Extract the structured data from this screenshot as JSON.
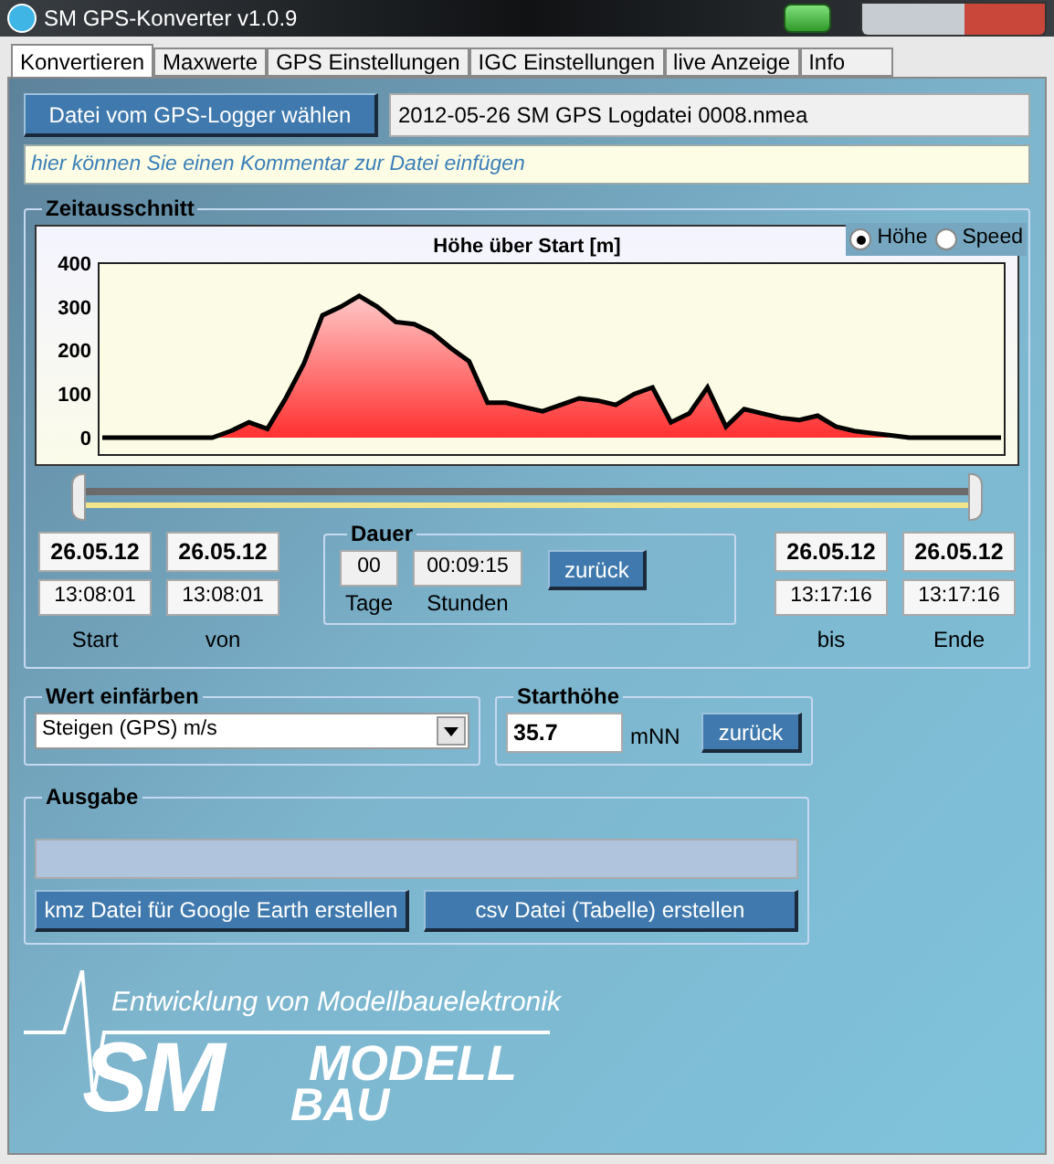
{
  "window": {
    "title": "SM GPS-Konverter v1.0.9"
  },
  "tabs": [
    {
      "label": "Konvertieren",
      "selected": true
    },
    {
      "label": "Maxwerte",
      "selected": false
    },
    {
      "label": "GPS Einstellungen",
      "selected": false
    },
    {
      "label": "IGC Einstellungen",
      "selected": false
    },
    {
      "label": "live Anzeige",
      "selected": false
    },
    {
      "label": "Info",
      "selected": false
    }
  ],
  "file": {
    "button": "Datei vom GPS-Logger wählen",
    "value": "2012-05-26 SM GPS Logdatei 0008.nmea",
    "comment_placeholder": "hier können Sie einen Kommentar zur Datei einfügen"
  },
  "zeitausschnitt": {
    "title": "Zeitausschnitt",
    "modes": [
      {
        "label": "Höhe",
        "selected": true
      },
      {
        "label": "Speed",
        "selected": false
      }
    ],
    "chart_data": {
      "type": "area",
      "title": "Höhe über Start [m]",
      "ylim": [
        -40,
        400
      ],
      "yticks": [
        0,
        100,
        200,
        300,
        400
      ],
      "categories": [
        null,
        null,
        null,
        null,
        null,
        null,
        null,
        null,
        null,
        null,
        null,
        null,
        null,
        null,
        null,
        null,
        null,
        null,
        null,
        null,
        null,
        null,
        null,
        null,
        null,
        null,
        null,
        null,
        null,
        null,
        null,
        null,
        null,
        null,
        null,
        null,
        null,
        null,
        null,
        null,
        null,
        null,
        null,
        null,
        null,
        null,
        null,
        null,
        null,
        null
      ],
      "series": [
        {
          "color": "#000000",
          "values": [
            0,
            0,
            0,
            0,
            0,
            0,
            0,
            15,
            35,
            20,
            90,
            170,
            280,
            300,
            325,
            300,
            265,
            260,
            240,
            205,
            175,
            80,
            80,
            70,
            60,
            75,
            90,
            85,
            75,
            100,
            115,
            35,
            55,
            115,
            25,
            65,
            55,
            45,
            40,
            50,
            25,
            15,
            10,
            5,
            0,
            0,
            0,
            0,
            0,
            0
          ]
        }
      ]
    },
    "slider": {
      "handles": [
        {
          "level": 0
        },
        {
          "level": 1
        }
      ]
    },
    "start": {
      "date": "26.05.12",
      "time": "13:08:01",
      "label": "Start"
    },
    "von": {
      "date": "26.05.12",
      "time": "13:08:01",
      "label": "von"
    },
    "dauer": {
      "title": "Dauer",
      "days": "00",
      "days_label": "Tage",
      "hours": "00:09:15",
      "hours_label": "Stunden",
      "button": "zurück"
    },
    "bis": {
      "date": "26.05.12",
      "time": "13:17:16",
      "label": "bis"
    },
    "ende": {
      "date": "26.05.12",
      "time": "13:17:16",
      "label": "Ende"
    }
  },
  "wert_einfaerben": {
    "title": "Wert einfärben",
    "value": "Steigen (GPS) m/s"
  },
  "starthoehe": {
    "title": "Starthöhe",
    "value": "35.7",
    "unit": "mNN",
    "button": "zurück"
  },
  "ausgabe": {
    "title": "Ausgabe",
    "progress": {
      "level": 0
    },
    "buttons": [
      "kmz Datei für Google Earth erstellen",
      "csv Datei (Tabelle) erstellen"
    ]
  },
  "logo": {
    "tagline": "Entwicklung von Modellbauelektronik",
    "sm": "SM",
    "modell": "MODELL",
    "bau": "BAU"
  }
}
